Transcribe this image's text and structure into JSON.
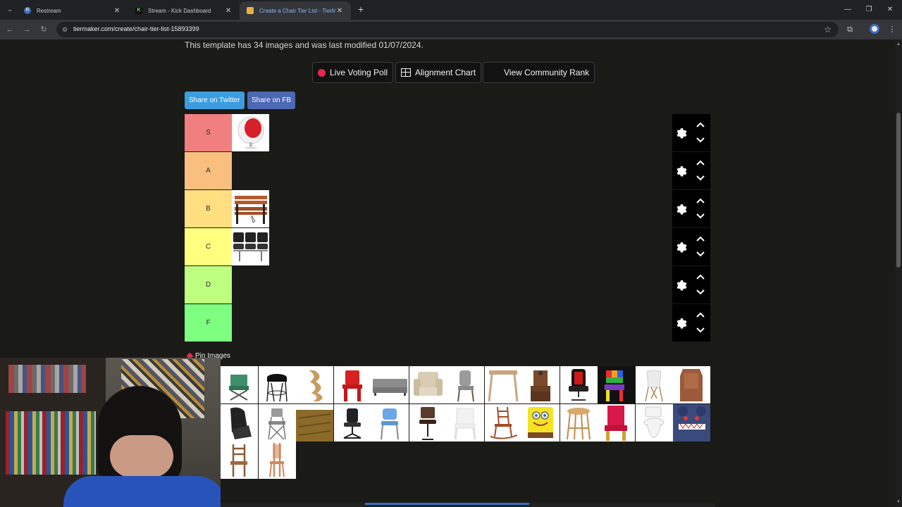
{
  "browser": {
    "tabs": [
      {
        "title": "Restream",
        "favicon_color": "#3d6cc0",
        "favicon_letter": "R",
        "active": false
      },
      {
        "title": "Stream - Kick Dashboard",
        "favicon_color": "#53fc18",
        "favicon_letter": "K",
        "active": false
      },
      {
        "title": "Create a Chair Tier List - TierMaker",
        "favicon_color": "#e8b040",
        "favicon_letter": "",
        "active": true
      }
    ],
    "url": "tiermaker.com/create/chair-tier-list-15893399"
  },
  "page": {
    "template_info": "This template has 34 images and was last modified 01/07/2024.",
    "buttons": {
      "live_voting": "Live Voting Poll",
      "alignment_chart": "Alignment Chart",
      "community_rank": "View Community Rank",
      "share_twitter": "Share on Twitter",
      "share_fb": "Share on FB"
    },
    "tiers": [
      {
        "label": "S",
        "color": "#f07f7f",
        "images": [
          "egg-chair"
        ]
      },
      {
        "label": "A",
        "color": "#f8bf7f",
        "images": []
      },
      {
        "label": "B",
        "color": "#ffdf80",
        "images": [
          "park-bench"
        ]
      },
      {
        "label": "C",
        "color": "#feff7f",
        "images": [
          "airport-seating"
        ]
      },
      {
        "label": "D",
        "color": "#bfff7f",
        "images": []
      },
      {
        "label": "F",
        "color": "#7fff7f",
        "images": []
      }
    ],
    "pin_images_label": "Pin Images",
    "pool_images": [
      "camping-chair",
      "bar-stool",
      "wave-wood-chair",
      "red-kids-chair",
      "gray-sofa",
      "beige-armchair",
      "dining-chair",
      "wood-table-stool",
      "electric-chair",
      "gaming-chair",
      "rainbow-chair",
      "white-eames-chair",
      "wood-throne",
      "massage-chair",
      "folding-chair",
      "hay-bale",
      "office-chair",
      "blue-school-chair",
      "swivel-bar-chair",
      "white-plastic-chair",
      "rocking-chair",
      "spongebob-chair",
      "wood-stool",
      "red-throne",
      "toilet",
      "monster-chair",
      "wood-ladder-chair",
      "tall-wood-chair"
    ]
  }
}
